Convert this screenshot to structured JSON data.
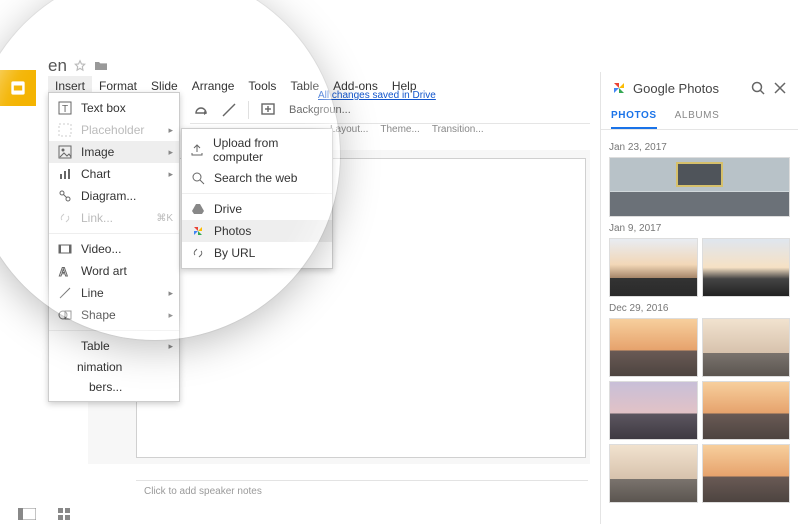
{
  "title_fragment": "en",
  "menubar": [
    "Insert",
    "Format",
    "Slide",
    "Arrange",
    "Tools",
    "Table",
    "Add-ons",
    "Help"
  ],
  "saved_note": "All changes saved in Drive",
  "toolbar": {
    "background": "Backgroun..."
  },
  "secondbar": [
    "Layout...",
    "Theme...",
    "Transition..."
  ],
  "speaker_placeholder": "Click to add speaker notes",
  "insert_menu": {
    "textbox": "Text box",
    "placeholder": "Placeholder",
    "image": "Image",
    "chart": "Chart",
    "diagram": "Diagram...",
    "link": "Link...",
    "link_shortcut": "⌘K",
    "video": "Video...",
    "wordart": "Word art",
    "line": "Line",
    "shape": "Shape",
    "table": "Table",
    "animation_tail": "nimation",
    "numbers_tail": "bers..."
  },
  "image_submenu": {
    "upload": "Upload from computer",
    "search": "Search the web",
    "drive": "Drive",
    "photos": "Photos",
    "byurl": "By URL"
  },
  "photos_panel": {
    "title": "Google Photos",
    "tabs": {
      "photos": "PHOTOS",
      "albums": "ALBUMS"
    },
    "groups": [
      {
        "date": "Jan 23, 2017",
        "layout": "single-wide",
        "items": [
          "building"
        ]
      },
      {
        "date": "Jan 9, 2017",
        "layout": "pair",
        "items": [
          "sunset",
          "sunset2"
        ]
      },
      {
        "date": "Dec 29, 2016",
        "layout": "grid2",
        "items": [
          "city",
          "city2",
          "purple",
          "city",
          "city2",
          "city"
        ]
      }
    ]
  }
}
